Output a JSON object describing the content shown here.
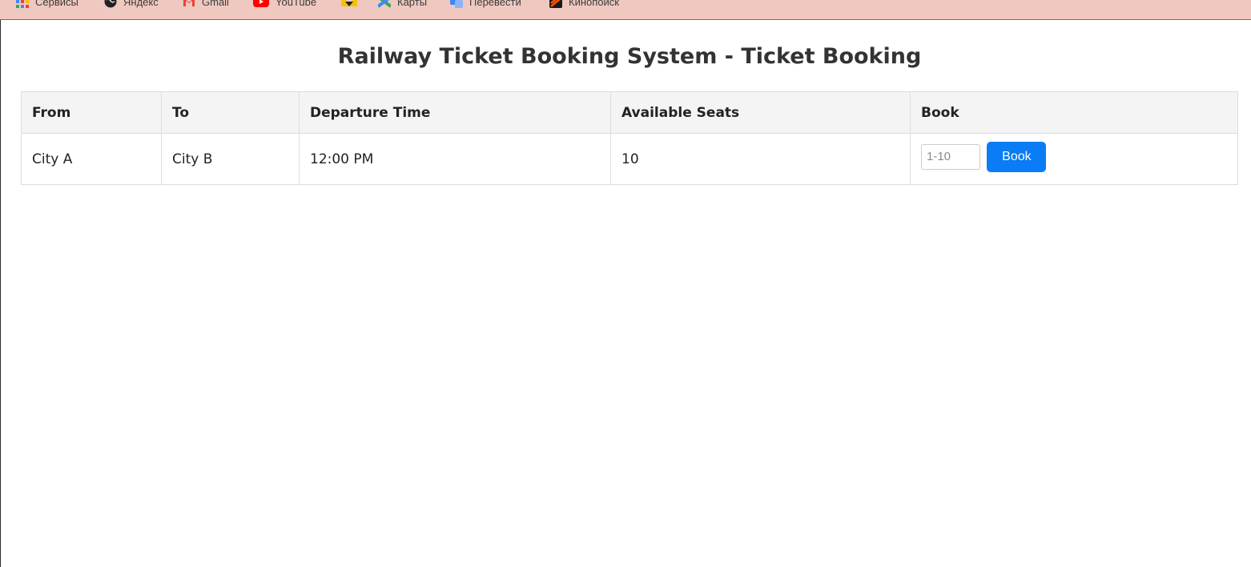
{
  "bookmarks": [
    {
      "label": "Сервисы",
      "icon": "apps-grid-icon"
    },
    {
      "label": "Яндекс",
      "icon": "globe-icon"
    },
    {
      "label": "Gmail",
      "icon": "gmail-icon"
    },
    {
      "label": "YouTube",
      "icon": "youtube-icon"
    },
    {
      "label": "",
      "icon": "yellow-logo-icon"
    },
    {
      "label": "Карты",
      "icon": "maps-icon"
    },
    {
      "label": "Перевести",
      "icon": "translate-icon"
    },
    {
      "label": "Кинопоиск",
      "icon": "kinopoisk-icon"
    }
  ],
  "page": {
    "title": "Railway Ticket Booking System - Ticket Booking"
  },
  "table": {
    "headers": [
      "From",
      "To",
      "Departure Time",
      "Available Seats",
      "Book"
    ],
    "rows": [
      {
        "from": "City A",
        "to": "City B",
        "departure": "12:00 PM",
        "seats": "10",
        "input_placeholder": "1-10",
        "book_label": "Book"
      }
    ]
  },
  "colors": {
    "bookmarks_bar": "#efc8c0",
    "button": "#0a7cf5",
    "header_bg": "#f4f4f4"
  }
}
